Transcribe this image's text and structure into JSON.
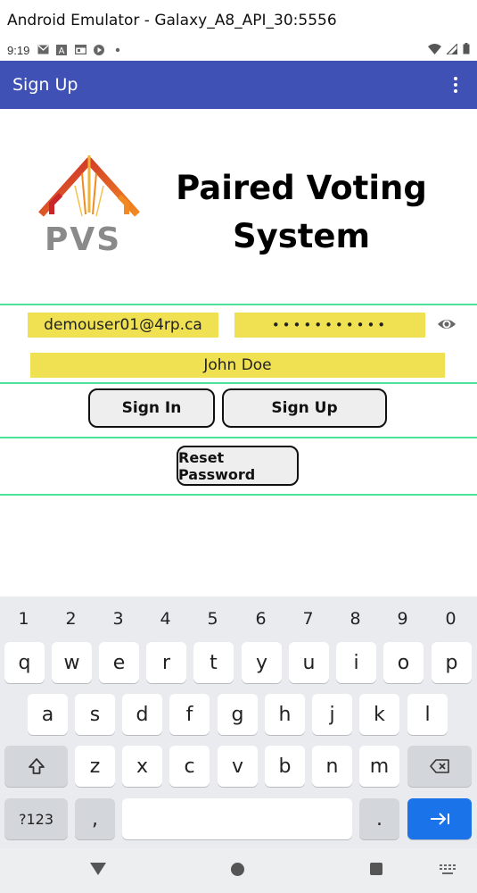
{
  "window": {
    "title": "Android Emulator - Galaxy_A8_API_30:5556"
  },
  "status_bar": {
    "time": "9:19",
    "left_icons": [
      "mail-icon",
      "a-icon",
      "calendar-icon",
      "play-icon",
      "dot-icon"
    ],
    "right_icons": [
      "wifi-icon",
      "signal-icon",
      "battery-icon"
    ]
  },
  "app_bar": {
    "title": "Sign Up",
    "menu_icon": "more-vert-icon",
    "color": "#3F51B5"
  },
  "logo": {
    "text": "PVS",
    "app_name_line1": "Paired Voting",
    "app_name_line2": "System"
  },
  "form": {
    "email_value": "demouser01@4rp.ca",
    "password_mask": "•••••••••••",
    "name_value": "John Doe",
    "field_color": "#efe152",
    "separator_color": "#4be39a"
  },
  "buttons": {
    "sign_in": "Sign In",
    "sign_up": "Sign Up",
    "reset_password": "Reset Password"
  },
  "keyboard": {
    "numbers": [
      "1",
      "2",
      "3",
      "4",
      "5",
      "6",
      "7",
      "8",
      "9",
      "0"
    ],
    "row1": [
      "q",
      "w",
      "e",
      "r",
      "t",
      "y",
      "u",
      "i",
      "o",
      "p"
    ],
    "row2": [
      "a",
      "s",
      "d",
      "f",
      "g",
      "h",
      "j",
      "k",
      "l"
    ],
    "row3": [
      "z",
      "x",
      "c",
      "v",
      "b",
      "n",
      "m"
    ],
    "symbols_label": "?123",
    "comma": ",",
    "period": ".",
    "action_color": "#1a73e8"
  },
  "nav_bar": {
    "icons": [
      "back-icon",
      "home-icon",
      "recents-icon",
      "keyboard-switch-icon"
    ]
  }
}
